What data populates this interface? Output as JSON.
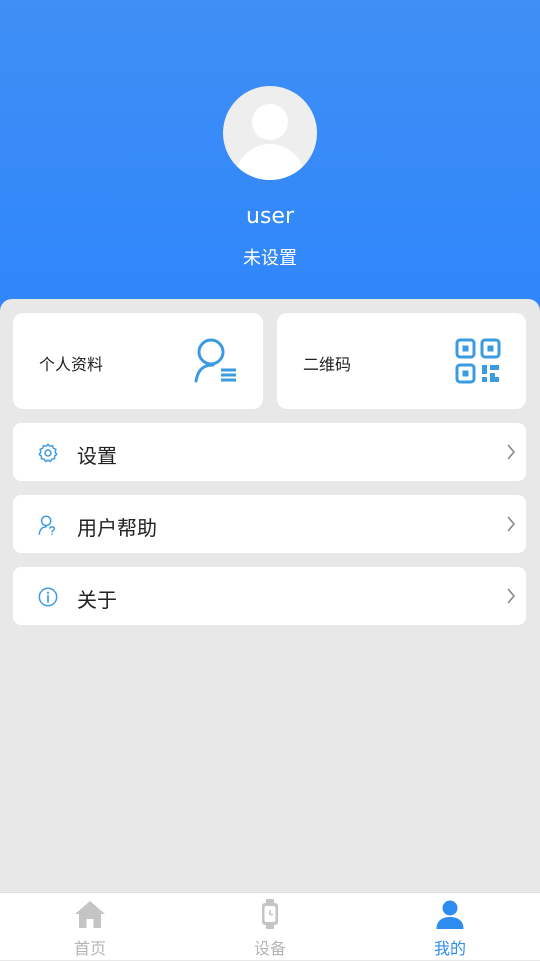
{
  "profile": {
    "username": "user",
    "status": "未设置"
  },
  "cards": [
    {
      "label": "个人资料",
      "icon": "profile-list-icon"
    },
    {
      "label": "二维码",
      "icon": "qr-code-icon"
    }
  ],
  "menu": [
    {
      "label": "设置",
      "icon": "gear-icon"
    },
    {
      "label": "用户帮助",
      "icon": "user-help-icon"
    },
    {
      "label": "关于",
      "icon": "info-icon"
    }
  ],
  "tabs": [
    {
      "label": "首页",
      "icon": "home-icon",
      "active": false
    },
    {
      "label": "设备",
      "icon": "watch-icon",
      "active": false
    },
    {
      "label": "我的",
      "icon": "person-icon",
      "active": true
    }
  ],
  "colors": {
    "header": "#2f86fb",
    "accent": "#2e8cf0",
    "icon": "#3a9be0",
    "inactive": "#b5b5b5"
  }
}
